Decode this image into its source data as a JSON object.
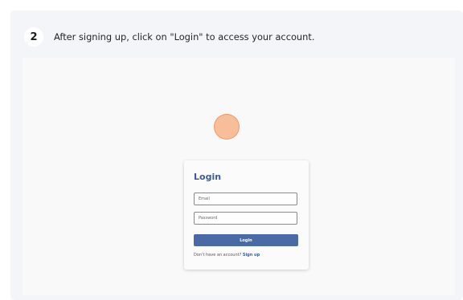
{
  "step": {
    "number": "2",
    "instruction": "After signing up, click on \"Login\" to access your account."
  },
  "login_form": {
    "title": "Login",
    "email_placeholder": "Email",
    "password_placeholder": "Password",
    "button_label": "Login",
    "signup_prompt": "Don't have an account?",
    "signup_link": "Sign up"
  },
  "colors": {
    "accent": "#4a69a7",
    "title": "#3b5c9d",
    "click_marker": "#f7aa78"
  }
}
